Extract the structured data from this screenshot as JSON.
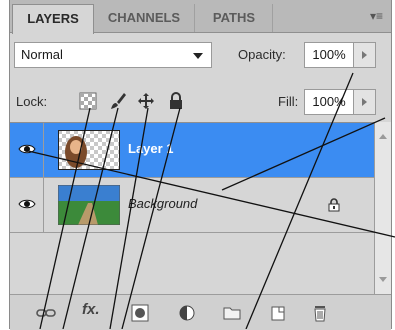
{
  "tabs": [
    {
      "label": "LAYERS",
      "active": true
    },
    {
      "label": "CHANNELS",
      "active": false
    },
    {
      "label": "PATHS",
      "active": false
    }
  ],
  "panel_menu_icon": "panel-menu-icon",
  "blend_mode": {
    "value": "Normal"
  },
  "opacity": {
    "label": "Opacity:",
    "value": "100%"
  },
  "lock": {
    "label": "Lock:"
  },
  "fill": {
    "label": "Fill:",
    "value": "100%"
  },
  "layers": [
    {
      "name": "Layer 1",
      "selected": true,
      "visible": true
    },
    {
      "name": "Background",
      "selected": false,
      "visible": true,
      "locked": true
    }
  ],
  "toolbar_icons": [
    "link-layers-icon",
    "fx-icon",
    "mask-icon",
    "adjustment-layer-icon",
    "group-folder-icon",
    "new-layer-icon",
    "trash-icon"
  ],
  "colors": {
    "selection": "#3b8cf2",
    "panel": "#d6d6d6"
  }
}
